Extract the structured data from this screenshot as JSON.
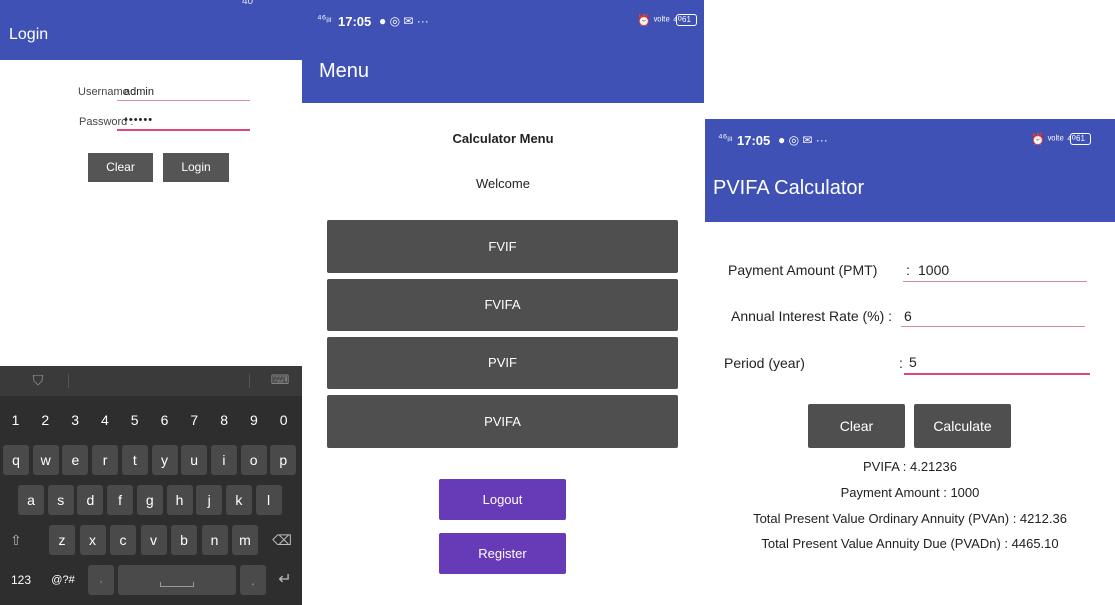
{
  "login": {
    "title": "Login",
    "status_partial": "40",
    "username_label": "Username :",
    "username_value": "admin",
    "password_label": "Password :",
    "password_value": "••••••",
    "clear_label": "Clear",
    "login_label": "Login"
  },
  "keyboard": {
    "row1": [
      "1",
      "2",
      "3",
      "4",
      "5",
      "6",
      "7",
      "8",
      "9",
      "0"
    ],
    "row2": [
      "q",
      "w",
      "e",
      "r",
      "t",
      "y",
      "u",
      "i",
      "o",
      "p"
    ],
    "row3": [
      "a",
      "s",
      "d",
      "f",
      "g",
      "h",
      "j",
      "k",
      "l"
    ],
    "row4": [
      "z",
      "x",
      "c",
      "v",
      "b",
      "n",
      "m"
    ],
    "shift": "⇧",
    "backspace": "⌫",
    "numsym": "123",
    "symbols": "@?#",
    "comma": ",",
    "period": ".",
    "enter": "↵",
    "shield": "⛉",
    "collapse": "⌨"
  },
  "menu": {
    "status": {
      "signal": "⁴⁶ᵢₗₗ",
      "time": "17:05",
      "icons": "● ◎ ✉ ···",
      "right_icons": "⏰ ᵛᵒˡᵗᵉ ⁴⁰",
      "battery": "61"
    },
    "title": "Menu",
    "heading": "Calculator Menu",
    "welcome": "Welcome",
    "items": [
      "FVIF",
      "FVIFA",
      "PVIF",
      "PVIFA"
    ],
    "logout_label": "Logout",
    "register_label": "Register"
  },
  "pvifa": {
    "status": {
      "signal": "⁴⁶ᵢₗₗ",
      "time": "17:05",
      "icons": "● ◎ ✉ ···",
      "right_icons": "⏰ ᵛᵒˡᵗᵉ ⁴⁰",
      "battery": "61"
    },
    "title": "PVIFA Calculator",
    "pmt_label": "Payment Amount (PMT)",
    "pmt_sep": ":",
    "pmt_value": "1000",
    "rate_label": "Annual Interest Rate (%) :",
    "rate_value": "6",
    "period_label": "Period (year)",
    "period_sep": ":",
    "period_value": "5",
    "clear_label": "Clear",
    "calculate_label": "Calculate",
    "result_pvifa": "PVIFA : 4.21236",
    "result_payment": "Payment Amount : 1000",
    "result_pvan": "Total Present Value Ordinary Annuity (PVAn) : 4212.36",
    "result_pvadn": "Total Present Value Annuity Due (PVADn) : 4465.10"
  },
  "colors": {
    "appbar": "#3f51b5",
    "accent_purple": "#673ab7",
    "button_gray": "#4f4f4f",
    "underline_pink": "#e0457b"
  }
}
